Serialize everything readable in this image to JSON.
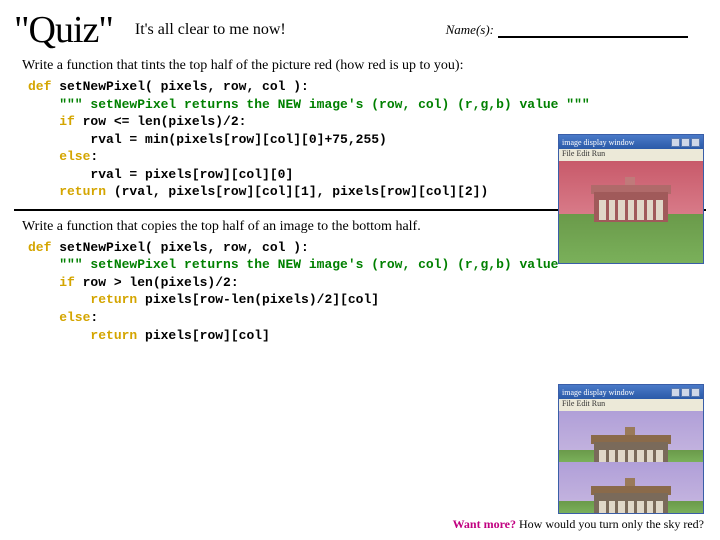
{
  "header": {
    "quiz": "\"Quiz\"",
    "subtitle": "It's all clear to me now!",
    "name_label": "Name(s):"
  },
  "q1": {
    "prompt": "Write a function that tints the top half of the picture red (how red is up to you):",
    "code": {
      "l1a": "def ",
      "l1b": "setNewPixel( pixels, row, col ):",
      "l2": "    \"\"\" setNewPixel returns the NEW image's (row, col) (r,g,b) value \"\"\"",
      "l3a": "    if",
      "l3b": " row <= len(pixels)/2:",
      "l4": "        rval = min(pixels[row][col][0]+75,255)",
      "l5a": "    else",
      "l5b": ":",
      "l6": "        rval = pixels[row][col][0]",
      "l7a": "    return ",
      "l7b": "(rval, pixels[row][col][1], pixels[row][col][2])"
    }
  },
  "q2": {
    "prompt": "Write a function that copies the top half of an image to the bottom half.",
    "code": {
      "l1a": "def ",
      "l1b": "setNewPixel( pixels, row, col ):",
      "l2": "    \"\"\" setNewPixel returns the NEW image's (row, col) (r,g,b) value \"\"\"",
      "l3a": "    if",
      "l3b": " row > len(pixels)/2:",
      "l4a": "        return ",
      "l4b": "pixels[row-len(pixels)/2][col]",
      "l5a": "    else",
      "l5b": ":",
      "l6a": "        return ",
      "l6b": "pixels[row][col]"
    }
  },
  "img_window": {
    "title": "image display window",
    "menu": "File   Edit   Run"
  },
  "footer": {
    "want_more": "Want more?",
    "extra": " How would you turn only the sky red?"
  }
}
